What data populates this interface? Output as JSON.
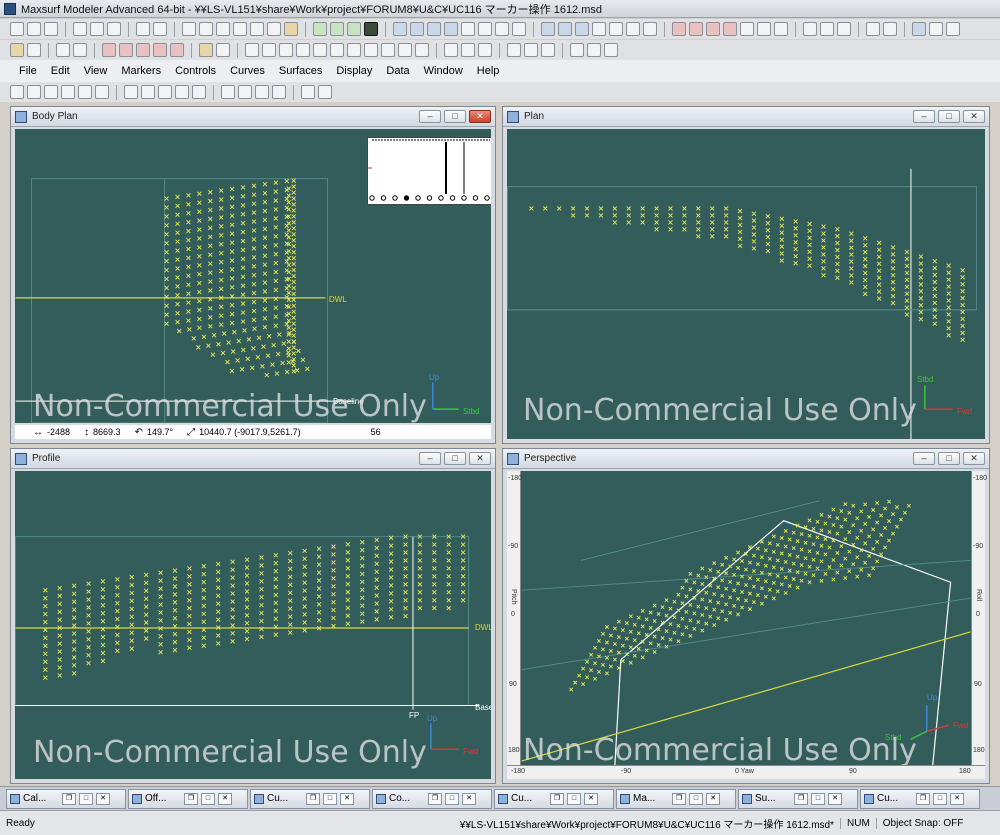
{
  "window": {
    "title": "Maxsurf Modeler Advanced 64-bit - ¥¥LS-VL151¥share¥Work¥project¥FORUM8¥U&C¥UC116 マーカー操作 1612.msd"
  },
  "menu": [
    "File",
    "Edit",
    "View",
    "Markers",
    "Controls",
    "Curves",
    "Surfaces",
    "Display",
    "Data",
    "Window",
    "Help"
  ],
  "views": {
    "body_plan": {
      "title": "Body Plan",
      "dwl": "DWL",
      "baseline": "Baseline",
      "up": "Up",
      "stbd": "Stbd"
    },
    "plan": {
      "title": "Plan",
      "stbd": "Stbd",
      "fwd": "Fwd"
    },
    "profile": {
      "title": "Profile",
      "dwl": "DWL",
      "base": "Base",
      "fp": "FP",
      "up": "Up",
      "fwd": "Fwd"
    },
    "perspective": {
      "title": "Perspective",
      "up": "Up",
      "stbd": "Stbd",
      "fwd": "Fwd",
      "left_ticks": [
        "-180",
        "-90",
        "0",
        "90",
        "180"
      ],
      "bottom_ticks": [
        "-180",
        "-90",
        "0 Yaw",
        "90",
        "180"
      ],
      "pitch": "Pitch",
      "roll": "Roll"
    }
  },
  "watermark": "Non-Commercial Use Only",
  "coord_bar": {
    "x": "-2488",
    "y": "8669.3",
    "angle": "149.7°",
    "dist": "10440.7 (-9017.9,5261.7)",
    "count": "56"
  },
  "minimized": [
    {
      "label": "Cal..."
    },
    {
      "label": "Off..."
    },
    {
      "label": "Cu..."
    },
    {
      "label": "Co..."
    },
    {
      "label": "Cu..."
    },
    {
      "label": "Ma..."
    },
    {
      "label": "Su..."
    },
    {
      "label": "Cu..."
    }
  ],
  "status": {
    "ready": "Ready",
    "file": "¥¥LS-VL151¥share¥Work¥project¥FORUM8¥U&C¥UC116 マーカー操作 1612.msd*",
    "num": "NUM",
    "snap": "Object Snap: OFF"
  },
  "colors": {
    "canvas": "#335d5a",
    "marker": "#e8e85a",
    "dwl": "#d8d840",
    "grid": "#4f8a88"
  }
}
